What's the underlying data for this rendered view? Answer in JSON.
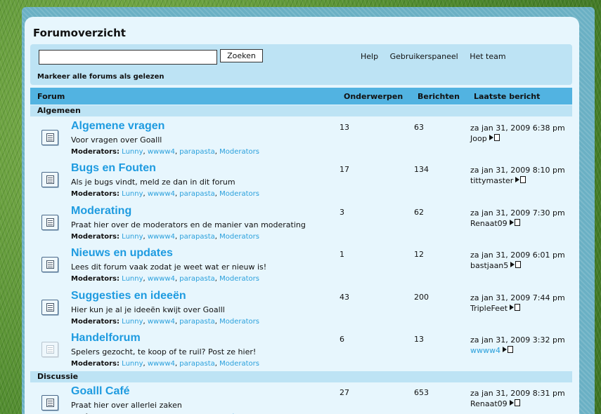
{
  "header": {
    "title": "Forumoverzicht"
  },
  "navbar": {
    "search_value": "",
    "search_button": "Zoeken",
    "links": [
      "Help",
      "Gebruikerspaneel",
      "Het team"
    ],
    "mark_read": "Markeer alle forums als gelezen"
  },
  "columns": {
    "forum": "Forum",
    "topics": "Onderwerpen",
    "posts": "Berichten",
    "last_post": "Laatste bericht"
  },
  "categories": [
    {
      "name": "Algemeen",
      "forums": [
        {
          "title": "Algemene vragen",
          "description": "Voor vragen over Goalll",
          "topics": "13",
          "posts": "63",
          "last_date": "za jan 31, 2009 6:38 pm",
          "last_author": "Joop",
          "read": false
        },
        {
          "title": "Bugs en Fouten",
          "description": "Als je bugs vindt, meld ze dan in dit forum",
          "topics": "17",
          "posts": "134",
          "last_date": "za jan 31, 2009 8:10 pm",
          "last_author": "tittymaster",
          "read": false
        },
        {
          "title": "Moderating",
          "description": "Praat hier over de moderators en de manier van moderating",
          "topics": "3",
          "posts": "62",
          "last_date": "za jan 31, 2009 7:30 pm",
          "last_author": "Renaat09",
          "read": false
        },
        {
          "title": "Nieuws en updates",
          "description": "Lees dit forum vaak zodat je weet wat er nieuw is!",
          "topics": "1",
          "posts": "12",
          "last_date": "za jan 31, 2009 6:01 pm",
          "last_author": "bastjaan5",
          "read": false
        },
        {
          "title": "Suggesties en ideeën",
          "description": "Hier kun je al je ideeën kwijt over Goalll",
          "topics": "43",
          "posts": "200",
          "last_date": "za jan 31, 2009 7:44 pm",
          "last_author": "TripleFeet",
          "read": false
        },
        {
          "title": "Handelforum",
          "description": "Spelers gezocht, te koop of te ruil? Post ze hier!",
          "topics": "6",
          "posts": "13",
          "last_date": "za jan 31, 2009 3:32 pm",
          "last_author": "wwww4",
          "read": true
        }
      ]
    },
    {
      "name": "Discussie",
      "forums": [
        {
          "title": "Goalll Café",
          "description": "Praat hier over allerlei zaken",
          "topics": "27",
          "posts": "653",
          "last_date": "za jan 31, 2009 8:31 pm",
          "last_author": "Renaat09",
          "read": false
        }
      ]
    }
  ],
  "moderators": {
    "label": "Moderators:",
    "names": [
      "Lunny",
      "wwww4",
      "parapasta",
      "Moderators"
    ]
  },
  "colors": {
    "link": "#1e9be0",
    "header_bar": "#52b3e1",
    "category_bar": "#bde3f4",
    "panel": "#e7f6fd"
  }
}
